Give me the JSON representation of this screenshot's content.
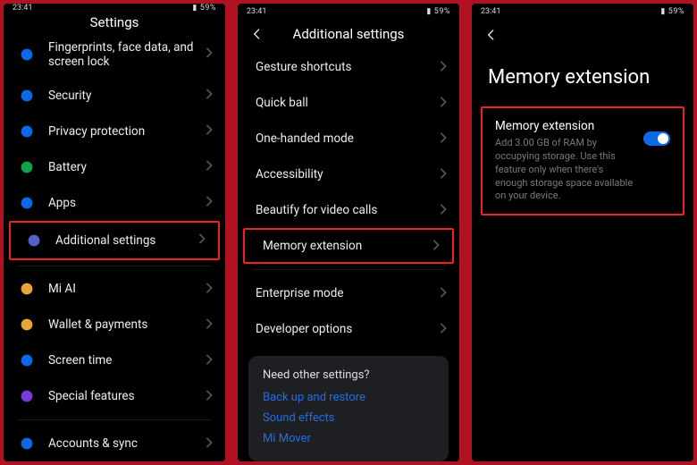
{
  "status": {
    "time": "23:41",
    "icons_text": "✱ ⏰ 📶 📶 🔋",
    "battery": "59%"
  },
  "panel1": {
    "title": "Settings",
    "items": [
      {
        "label": "Fingerprints, face data, and screen lock",
        "icon": "fingerprint-icon",
        "color": "#0c6ae6"
      },
      {
        "label": "Security",
        "icon": "shield-icon",
        "color": "#0c6ae6"
      },
      {
        "label": "Privacy protection",
        "icon": "lock-icon",
        "color": "#0c6ae6"
      },
      {
        "label": "Battery",
        "icon": "battery-icon",
        "color": "#12a34a"
      },
      {
        "label": "Apps",
        "icon": "gear-icon",
        "color": "#0c6ae6"
      },
      {
        "label": "Additional settings",
        "icon": "sliders-icon",
        "color": "#5560c8",
        "highlight": true
      }
    ],
    "items2": [
      {
        "label": "Mi AI",
        "icon": "ai-icon",
        "color": "#e8a53a"
      },
      {
        "label": "Wallet & payments",
        "icon": "wallet-icon",
        "color": "#e8a53a"
      },
      {
        "label": "Screen time",
        "icon": "timer-icon",
        "color": "#0c6ae6"
      },
      {
        "label": "Special features",
        "icon": "star-icon",
        "color": "#7a3ad8"
      }
    ],
    "items3": [
      {
        "label": "Accounts & sync",
        "icon": "sync-icon",
        "color": "#0c6ae6"
      }
    ]
  },
  "panel2": {
    "title": "Additional settings",
    "items": [
      {
        "label": "Gesture shortcuts"
      },
      {
        "label": "Quick ball"
      },
      {
        "label": "One-handed mode"
      },
      {
        "label": "Accessibility"
      },
      {
        "label": "Beautify for video calls"
      },
      {
        "label": "Memory extension",
        "highlight": true
      }
    ],
    "items2": [
      {
        "label": "Enterprise mode"
      },
      {
        "label": "Developer options"
      }
    ],
    "card": {
      "head": "Need other settings?",
      "links": [
        "Back up and restore",
        "Sound effects",
        "Mi Mover"
      ]
    }
  },
  "panel3": {
    "title": "Memory extension",
    "block": {
      "title": "Memory extension",
      "desc": "Add 3.00 GB of RAM by occupying storage. Use this feature only when there's enough storage space available on your device.",
      "toggle_on": true
    }
  }
}
